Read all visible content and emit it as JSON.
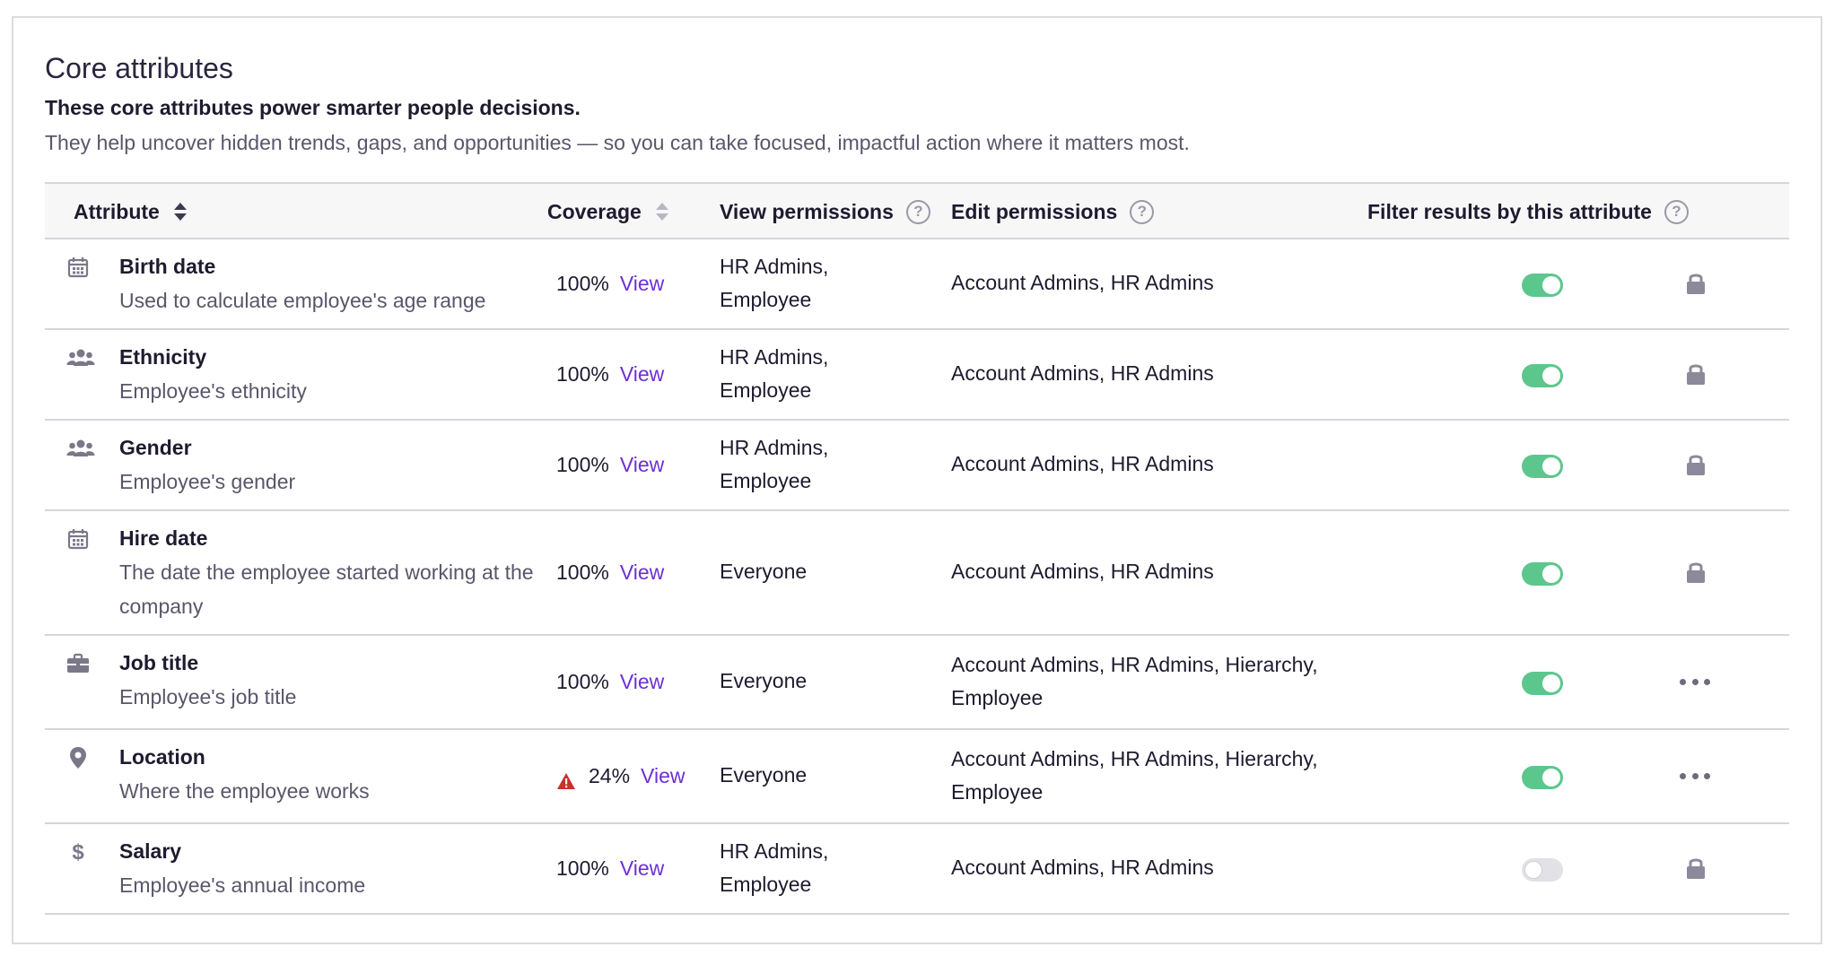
{
  "header": {
    "title": "Core attributes",
    "subtitle": "These core attributes power smarter people decisions.",
    "description": "They help uncover hidden trends, gaps, and opportunities — so you can take focused, impactful action where it matters most."
  },
  "columns": {
    "attribute": "Attribute",
    "coverage": "Coverage",
    "view_permissions": "View permissions",
    "edit_permissions": "Edit permissions",
    "filter": "Filter results by this attribute",
    "help_glyph": "?"
  },
  "rows": [
    {
      "icon": "calendar-icon",
      "name": "Birth date",
      "desc": "Used to calculate employee's age range",
      "coverage": "100%",
      "coverage_warning": false,
      "view_link": "View",
      "view_perm": "HR Admins, Employee",
      "edit_perm": "Account Admins, HR Admins",
      "filter_on": true,
      "action": "lock-icon"
    },
    {
      "icon": "people-icon",
      "name": "Ethnicity",
      "desc": "Employee's ethnicity",
      "coverage": "100%",
      "coverage_warning": false,
      "view_link": "View",
      "view_perm": "HR Admins, Employee",
      "edit_perm": "Account Admins, HR Admins",
      "filter_on": true,
      "action": "lock-icon"
    },
    {
      "icon": "people-icon",
      "name": "Gender",
      "desc": "Employee's gender",
      "coverage": "100%",
      "coverage_warning": false,
      "view_link": "View",
      "view_perm": "HR Admins, Employee",
      "edit_perm": "Account Admins, HR Admins",
      "filter_on": true,
      "action": "lock-icon"
    },
    {
      "icon": "calendar-icon",
      "name": "Hire date",
      "desc": "The date the employee started working at the company",
      "coverage": "100%",
      "coverage_warning": false,
      "view_link": "View",
      "view_perm": "Everyone",
      "edit_perm": "Account Admins, HR Admins",
      "filter_on": true,
      "action": "lock-icon"
    },
    {
      "icon": "briefcase-icon",
      "name": "Job title",
      "desc": "Employee's job title",
      "coverage": "100%",
      "coverage_warning": false,
      "view_link": "View",
      "view_perm": "Everyone",
      "edit_perm": "Account Admins, HR Admins, Hierarchy, Employee",
      "filter_on": true,
      "action": "more-icon"
    },
    {
      "icon": "location-pin-icon",
      "name": "Location",
      "desc": "Where the employee works",
      "coverage": "24%",
      "coverage_warning": true,
      "view_link": "View",
      "view_perm": "Everyone",
      "edit_perm": "Account Admins, HR Admins, Hierarchy, Employee",
      "filter_on": true,
      "action": "more-icon"
    },
    {
      "icon": "dollar-icon",
      "name": "Salary",
      "desc": "Employee's annual income",
      "coverage": "100%",
      "coverage_warning": false,
      "view_link": "View",
      "view_perm": "HR Admins, Employee",
      "edit_perm": "Account Admins, HR Admins",
      "filter_on": false,
      "action": "lock-icon"
    }
  ],
  "colors": {
    "link": "#6d2fd6",
    "toggle_on": "#5cc78c",
    "toggle_off": "#e2e1e6",
    "warning": "#c8322b"
  }
}
